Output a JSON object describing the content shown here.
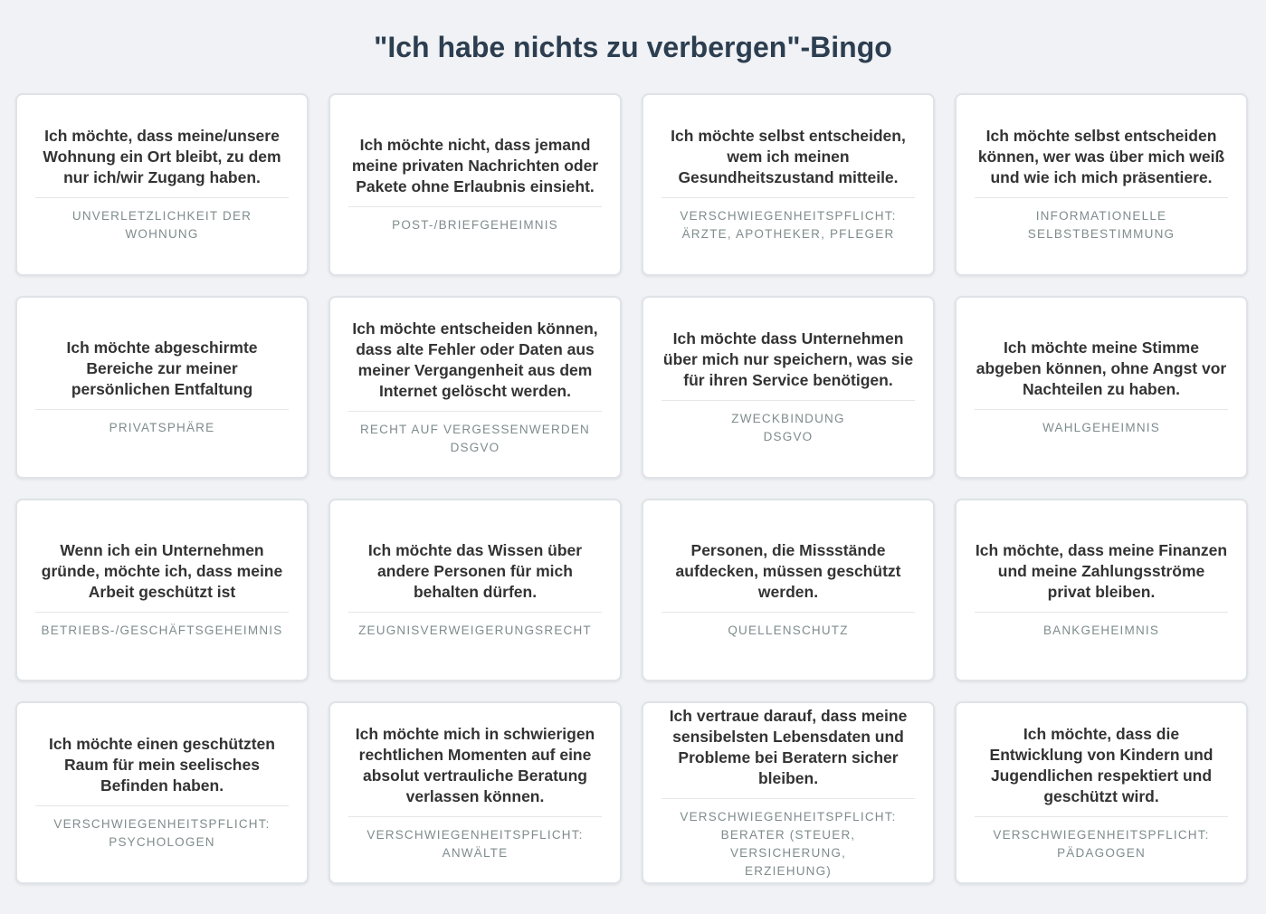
{
  "title": "\"Ich habe nichts zu verbergen\"-Bingo",
  "cards": [
    {
      "text": "Ich möchte, dass meine/unsere Wohnung ein Ort bleibt, zu dem nur ich/wir Zugang haben.",
      "right": "UNVERLETZLICHKEIT DER WOHNUNG"
    },
    {
      "text": "Ich möchte nicht, dass jemand meine privaten Nachrichten oder Pakete ohne Erlaubnis einsieht.",
      "right": "POST-/BRIEFGEHEIMNIS"
    },
    {
      "text": "Ich möchte selbst entscheiden, wem ich meinen Gesundheitszustand mitteile.",
      "right": "VERSCHWIEGENHEITSPFLICHT:\nÄRZTE, APOTHEKER, PFLEGER"
    },
    {
      "text": "Ich möchte selbst entscheiden können, wer was über mich weiß und wie ich mich präsentiere.",
      "right": "INFORMATIONELLE\nSELBSTBESTIMMUNG"
    },
    {
      "text": "Ich möchte abgeschirmte Bereiche zur meiner persönlichen Entfaltung",
      "right": "PRIVATSPHÄRE"
    },
    {
      "text": "Ich möchte entscheiden können, dass alte Fehler oder Daten aus meiner Vergangenheit aus dem Internet gelöscht werden.",
      "right": "RECHT AUF VERGESSENWERDEN\nDSGVO"
    },
    {
      "text": "Ich möchte dass Unternehmen über mich nur speichern, was sie für ihren Service benötigen.",
      "right": "ZWECKBINDUNG\nDSGVO"
    },
    {
      "text": "Ich möchte meine Stimme abgeben können, ohne Angst vor Nachteilen zu haben.",
      "right": "WAHLGEHEIMNIS"
    },
    {
      "text": "Wenn ich ein Unternehmen gründe, möchte ich, dass meine Arbeit geschützt ist",
      "right": "BETRIEBS-/GESCHÄFTSGEHEIMNIS"
    },
    {
      "text": "Ich möchte das Wissen über andere Personen für mich behalten dürfen.",
      "right": "ZEUGNISVERWEIGERUNGSRECHT"
    },
    {
      "text": "Personen, die Missstände aufdecken, müssen geschützt werden.",
      "right": "QUELLENSCHUTZ"
    },
    {
      "text": "Ich möchte, dass meine Finanzen und meine Zahlungsströme privat bleiben.",
      "right": "BANKGEHEIMNIS"
    },
    {
      "text": "Ich möchte einen geschützten Raum für mein seelisches Befinden haben.",
      "right": "VERSCHWIEGENHEITSPFLICHT:\nPSYCHOLOGEN"
    },
    {
      "text": "Ich möchte mich in schwierigen rechtlichen Momenten auf eine absolut vertrauliche Beratung verlassen können.",
      "right": "VERSCHWIEGENHEITSPFLICHT:\nANWÄLTE"
    },
    {
      "text": "Ich vertraue darauf, dass meine sensibelsten Lebensdaten und Probleme bei Beratern sicher bleiben.",
      "right": "VERSCHWIEGENHEITSPFLICHT:\nBERATER (STEUER, VERSICHERUNG,\nERZIEHUNG)"
    },
    {
      "text": "Ich möchte, dass die Entwicklung von Kindern und Jugendlichen respektiert und geschützt wird.",
      "right": "VERSCHWIEGENHEITSPFLICHT:\nPÄDAGOGEN"
    }
  ]
}
